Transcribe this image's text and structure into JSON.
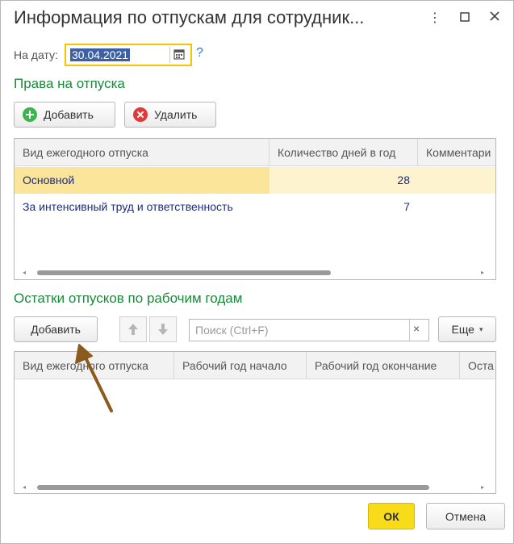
{
  "window": {
    "title": "Информация по отпускам для сотрудник...",
    "icons": [
      "more-vertical-icon",
      "maximize-icon",
      "close-icon"
    ]
  },
  "date_row": {
    "label": "На дату:",
    "value": "30.04.2021",
    "help": "?"
  },
  "rights": {
    "section_title": "Права на отпуска",
    "add_label": "Добавить",
    "delete_label": "Удалить",
    "columns": [
      "Вид ежегодного отпуска",
      "Количество дней в год",
      "Комментари"
    ],
    "rows": [
      {
        "type": "Основной",
        "days": "28",
        "comment": ""
      },
      {
        "type": "За интенсивный труд и ответственность",
        "days": "7",
        "comment": ""
      }
    ]
  },
  "balances": {
    "section_title": "Остатки отпусков по рабочим годам",
    "add_label": "Добавить",
    "search_placeholder": "Поиск (Ctrl+F)",
    "clear_label": "×",
    "more_label": "Еще",
    "columns": [
      "Вид ежегодного отпуска",
      "Рабочий год начало",
      "Рабочий год окончание",
      "Оста"
    ]
  },
  "footer": {
    "ok_label": "ОК",
    "cancel_label": "Отмена"
  },
  "colors": {
    "section": "#1a8a3a",
    "selected_row": "#fae59a",
    "ok_button": "#f8dc1a",
    "annotation_arrow": "#8a5a1e"
  }
}
